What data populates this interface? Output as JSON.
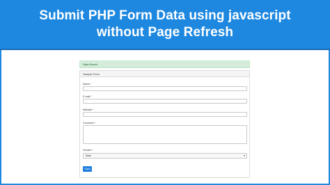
{
  "banner": {
    "line1": "Submit PHP Form Data using javascript",
    "line2": "without Page Refresh"
  },
  "alert": {
    "text": "Data Saved"
  },
  "form": {
    "header": "Sample Form",
    "name_label": "Name *",
    "email_label": "E-mail *",
    "website_label": "Website *",
    "comment_label": "Comment *",
    "gender_label": "Gender *",
    "gender_selected": "Male",
    "save_label": "Save"
  },
  "colors": {
    "banner_bg": "#1e88e0",
    "alert_bg": "#d4edda",
    "button_bg": "#1e7ee0"
  },
  "icons": {
    "select_caret": "chevron-down-icon"
  }
}
